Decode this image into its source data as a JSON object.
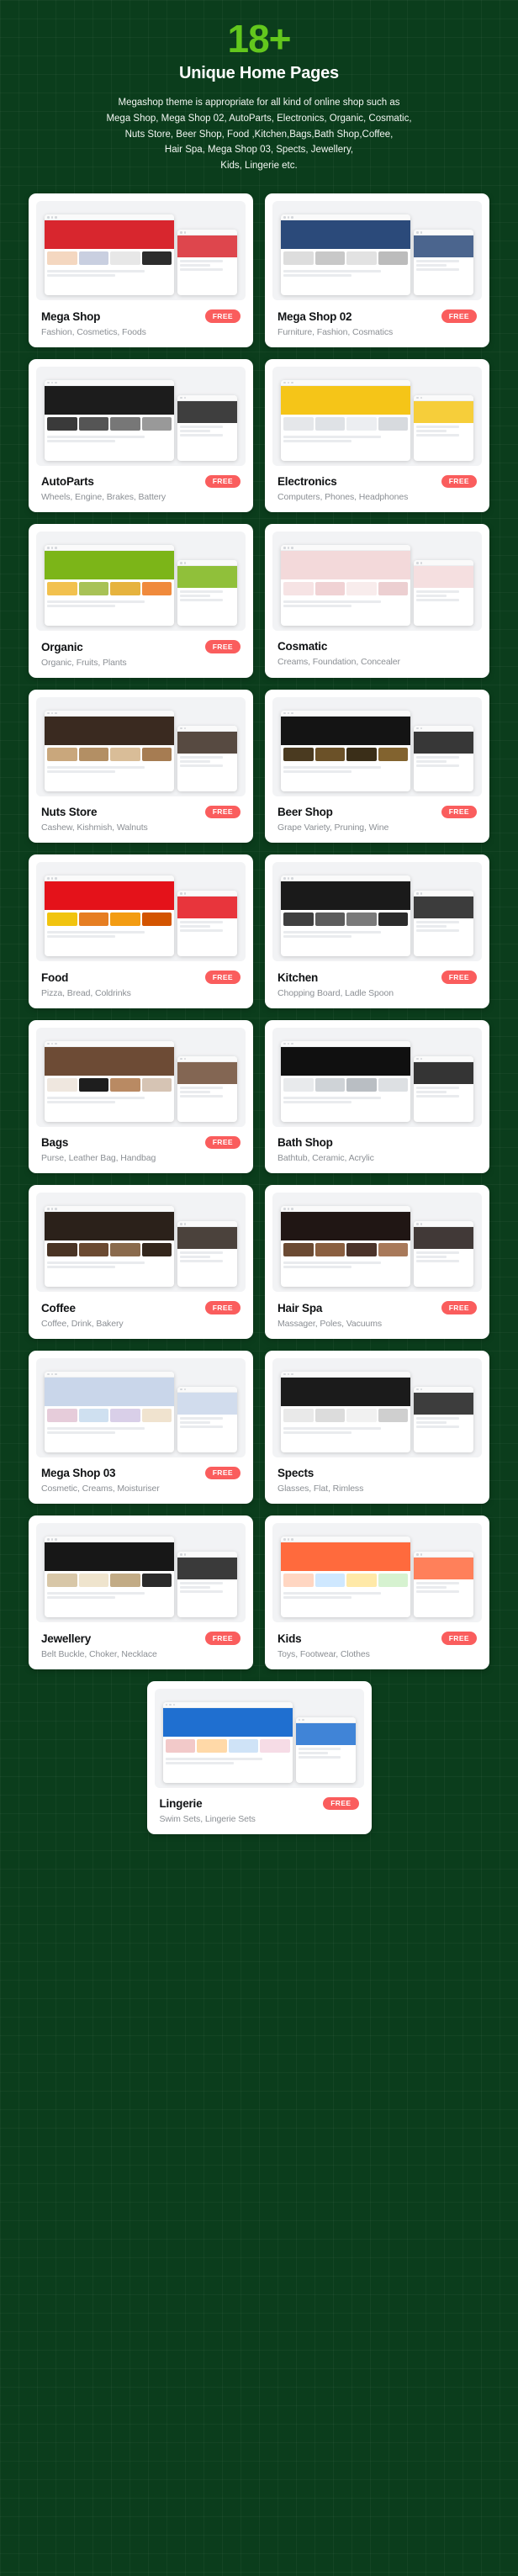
{
  "hero": {
    "count": "18+",
    "title": "Unique Home Pages",
    "desc_lines": [
      "Megashop theme is appropriate for all kind of online shop such as",
      "Mega Shop, Mega Shop 02, AutoParts, Electronics, Organic, Cosmatic,",
      "Nuts Store, Beer Shop, Food ,Kitchen,Bags,Bath Shop,Coffee,",
      "Hair Spa, Mega Shop 03, Spects, Jewellery,",
      "Kids, Lingerie etc."
    ]
  },
  "colors": {
    "background": "#0b3d1c",
    "accent_green": "#63c71d",
    "badge_red": "#fa5d5d",
    "card_white": "#ffffff",
    "title_dark": "#111315",
    "subtitle_gray": "#8b8f94"
  },
  "badge_label": "FREE",
  "cards": [
    {
      "title": "Mega Shop",
      "subtitle": "Fashion, Cosmetics, Foods",
      "badge": "FREE",
      "free": true,
      "hero_color": "#d8262e",
      "strip": [
        "#f4d7c0",
        "#c9cfe0",
        "#e7e7e7",
        "#2c2c2c"
      ]
    },
    {
      "title": "Mega Shop 02",
      "subtitle": "Furniture, Fashion, Cosmatics",
      "badge": "FREE",
      "free": true,
      "hero_color": "#2b4a7a",
      "strip": [
        "#dddddd",
        "#c8c8c8",
        "#e2e2e2",
        "#bcbcbc"
      ]
    },
    {
      "title": "AutoParts",
      "subtitle": "Wheels, Engine, Brakes, Battery",
      "badge": "FREE",
      "free": true,
      "hero_color": "#1c1c1c",
      "strip": [
        "#3a3a3a",
        "#555555",
        "#777777",
        "#999999"
      ]
    },
    {
      "title": "Electronics",
      "subtitle": "Computers, Phones, Headphones",
      "badge": "FREE",
      "free": true,
      "hero_color": "#f5c518",
      "strip": [
        "#e5e7ea",
        "#dfe2e6",
        "#eceef1",
        "#d7dade"
      ]
    },
    {
      "title": "Organic",
      "subtitle": "Organic, Fruits, Plants",
      "badge": "FREE",
      "free": true,
      "hero_color": "#7cb518",
      "strip": [
        "#f2c14e",
        "#a8c256",
        "#e6b33e",
        "#f08a3c"
      ]
    },
    {
      "title": "Cosmatic",
      "subtitle": "Creams, Foundation, Concealer",
      "badge": "",
      "free": false,
      "hero_color": "#f3d9da",
      "strip": [
        "#f6e3e4",
        "#f0d2d4",
        "#f8ecec",
        "#eccfd1"
      ]
    },
    {
      "title": "Nuts Store",
      "subtitle": "Cashew, Kishmish, Walnuts",
      "badge": "FREE",
      "free": true,
      "hero_color": "#3a2a20",
      "strip": [
        "#c9a77c",
        "#b38f64",
        "#d9bd98",
        "#a67c52"
      ]
    },
    {
      "title": "Beer Shop",
      "subtitle": "Grape Variety, Pruning, Wine",
      "badge": "FREE",
      "free": true,
      "hero_color": "#141414",
      "strip": [
        "#4a3a20",
        "#6b5128",
        "#3a2e18",
        "#82632f"
      ]
    },
    {
      "title": "Food",
      "subtitle": "Pizza, Bread, Coldrinks",
      "badge": "FREE",
      "free": true,
      "hero_color": "#e4121a",
      "strip": [
        "#f1c40f",
        "#e67e22",
        "#f39c12",
        "#d35400"
      ]
    },
    {
      "title": "Kitchen",
      "subtitle": "Chopping Board, Ladle Spoon",
      "badge": "FREE",
      "free": true,
      "hero_color": "#1a1a1a",
      "strip": [
        "#3f3f3f",
        "#5c5c5c",
        "#7a7a7a",
        "#2b2b2b"
      ]
    },
    {
      "title": "Bags",
      "subtitle": "Purse, Leather Bag, Handbag",
      "badge": "FREE",
      "free": true,
      "hero_color": "#6d4b35",
      "strip": [
        "#efe7df",
        "#1e1e1e",
        "#b98a63",
        "#d6c4b4"
      ]
    },
    {
      "title": "Bath Shop",
      "subtitle": "Bathtub, Ceramic, Acrylic",
      "badge": "",
      "free": false,
      "hero_color": "#101010",
      "strip": [
        "#e8eaec",
        "#cfd3d7",
        "#b9bec3",
        "#dde0e3"
      ]
    },
    {
      "title": "Coffee",
      "subtitle": "Coffee, Drink, Bakery",
      "badge": "FREE",
      "free": true,
      "hero_color": "#2b211a",
      "strip": [
        "#4a3425",
        "#6b4a32",
        "#8a6a4c",
        "#33261c"
      ]
    },
    {
      "title": "Hair Spa",
      "subtitle": "Massager, Poles, Vacuums",
      "badge": "FREE",
      "free": true,
      "hero_color": "#201614",
      "strip": [
        "#6b4a33",
        "#8a5f40",
        "#4b332a",
        "#a8795a"
      ]
    },
    {
      "title": "Mega Shop 03",
      "subtitle": "Cosmetic, Creams, Moisturiser",
      "badge": "FREE",
      "free": true,
      "hero_color": "#c9d6ea",
      "strip": [
        "#e6ccda",
        "#cfe0f0",
        "#d9cfe8",
        "#f0e3cf"
      ]
    },
    {
      "title": "Spects",
      "subtitle": "Glasses, Flat, Rimless",
      "badge": "",
      "free": false,
      "hero_color": "#1b1b1b",
      "strip": [
        "#e9e9e9",
        "#dcdcdc",
        "#f1f1f1",
        "#cfcfcf"
      ]
    },
    {
      "title": "Jewellery",
      "subtitle": "Belt Buckle, Choker, Necklace",
      "badge": "FREE",
      "free": true,
      "hero_color": "#171717",
      "strip": [
        "#d8c7a8",
        "#efe4cd",
        "#c2ab85",
        "#2a2a2a"
      ]
    },
    {
      "title": "Kids",
      "subtitle": "Toys, Footwear, Clothes",
      "badge": "FREE",
      "free": true,
      "hero_color": "#ff6a3d",
      "strip": [
        "#ffd6c2",
        "#cfe8ff",
        "#ffe9a8",
        "#d6f2d0"
      ]
    },
    {
      "title": "Lingerie",
      "subtitle": "Swim Sets, Lingerie Sets",
      "badge": "FREE",
      "free": true,
      "hero_color": "#1f6fd0",
      "strip": [
        "#f2c9c9",
        "#ffd9a8",
        "#cfe3f7",
        "#f6dce6"
      ]
    }
  ]
}
